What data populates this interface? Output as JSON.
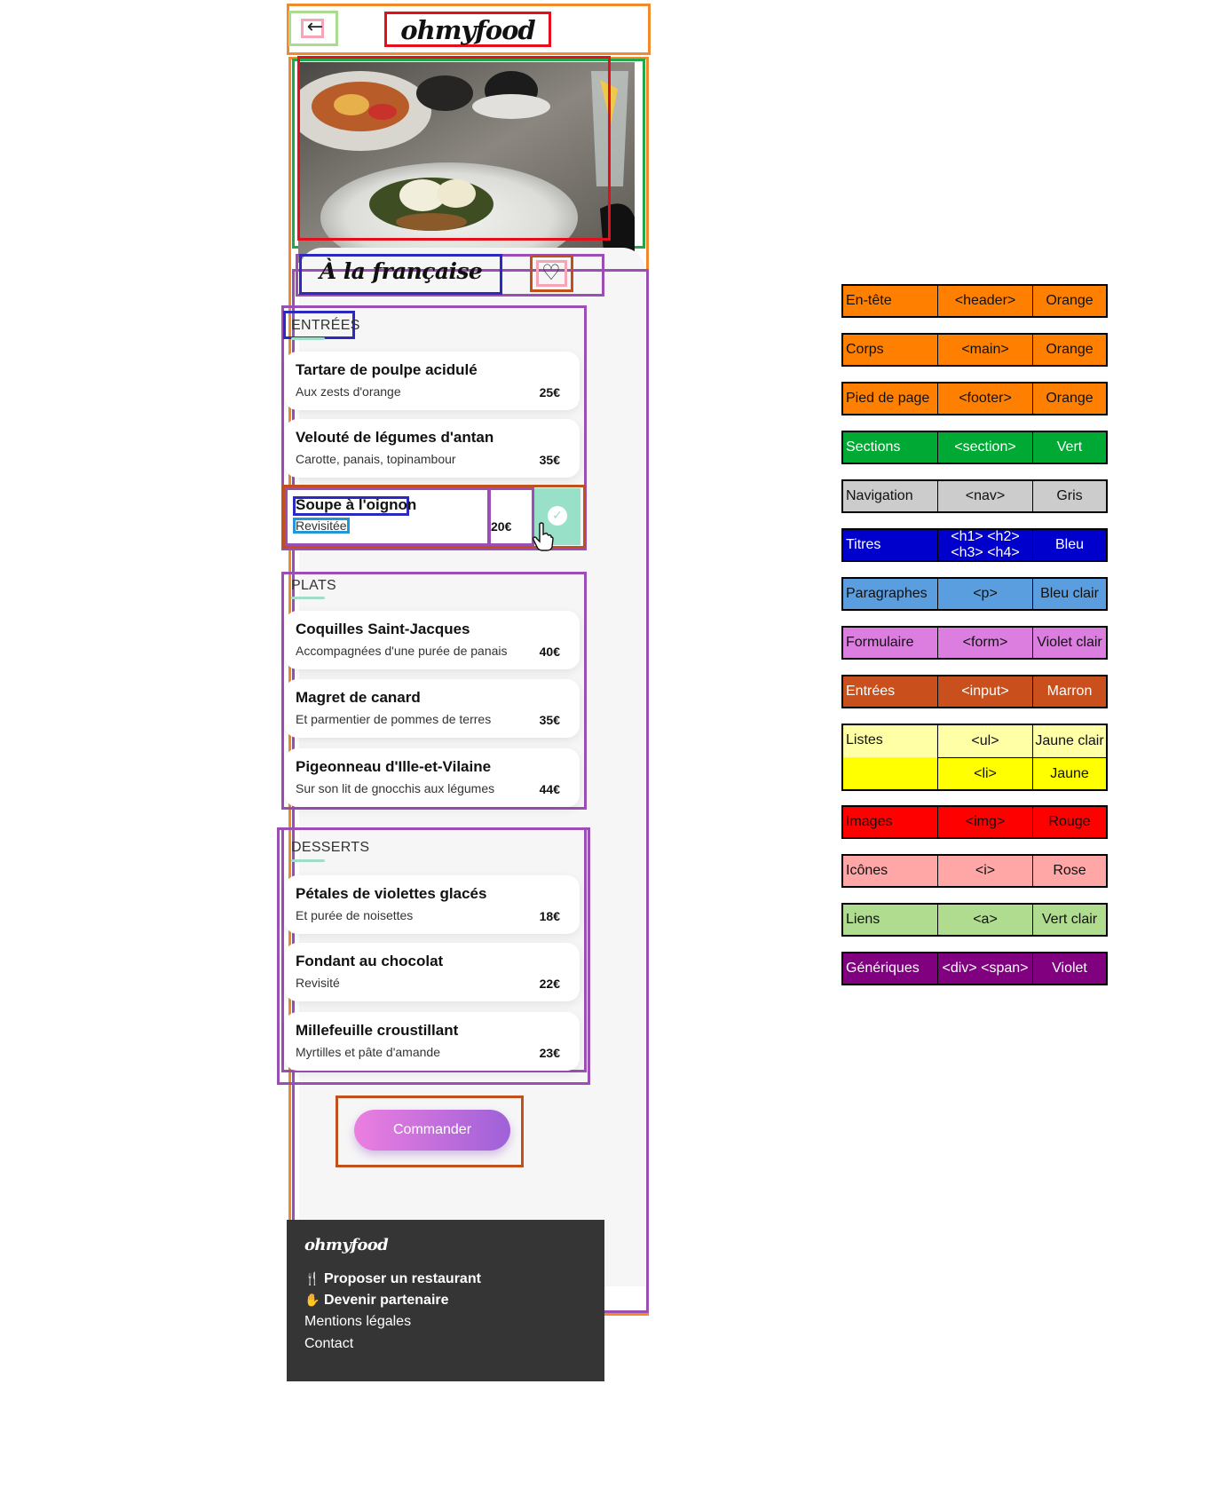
{
  "header": {
    "logo": "ohmyfood",
    "back_icon": "arrow-left-icon"
  },
  "restaurant": {
    "title": "À la française",
    "like_icon": "heart-icon"
  },
  "sections": [
    {
      "title": "ENTRÉES",
      "dishes": [
        {
          "name": "Tartare de poulpe acidulé",
          "desc": "Aux zests d'orange",
          "price": "25€"
        },
        {
          "name": "Velouté de légumes d'antan",
          "desc": "Carotte, panais, topinambour",
          "price": "35€"
        },
        {
          "name": "Soupe à l'oignon",
          "desc": "Revisitée",
          "price": "20€",
          "selected": true
        }
      ]
    },
    {
      "title": "PLATS",
      "dishes": [
        {
          "name": "Coquilles Saint-Jacques",
          "desc": "Accompagnées d'une purée de panais",
          "price": "40€"
        },
        {
          "name": "Magret de canard",
          "desc": "Et parmentier de pommes de terres",
          "price": "35€"
        },
        {
          "name": "Pigeonneau d'Ille-et-Vilaine",
          "desc": "Sur son lit de gnocchis aux légumes",
          "price": "44€"
        }
      ]
    },
    {
      "title": "DESSERTS",
      "dishes": [
        {
          "name": "Pétales de violettes glacés",
          "desc": "Et purée de noisettes",
          "price": "18€"
        },
        {
          "name": "Fondant au chocolat",
          "desc": "Revisité",
          "price": "22€"
        },
        {
          "name": "Millefeuille croustillant",
          "desc": "Myrtilles et pâte d'amande",
          "price": "23€"
        }
      ]
    }
  ],
  "order_button": "Commander",
  "footer": {
    "logo": "ohmyfood",
    "links": [
      {
        "label": "Proposer un restaurant",
        "icon": "utensils-icon"
      },
      {
        "label": "Devenir partenaire",
        "icon": "handshake-icon"
      },
      {
        "label": "Mentions légales"
      },
      {
        "label": "Contact"
      }
    ]
  },
  "legend": [
    {
      "name": "En-tête",
      "tag": "<header>",
      "color": "Orange",
      "hex": "#ff8000"
    },
    {
      "name": "Corps",
      "tag": "<main>",
      "color": "Orange",
      "hex": "#ff8000"
    },
    {
      "name": "Pied de page",
      "tag": "<footer>",
      "color": "Orange",
      "hex": "#ff8000"
    },
    {
      "name": "Sections",
      "tag": "<section>",
      "color": "Vert",
      "hex": "#00a933",
      "light_text": true
    },
    {
      "name": "Navigation",
      "tag": "<nav>",
      "color": "Gris",
      "hex": "#cccccc"
    },
    {
      "name": "Titres",
      "tag": "<h1> <h2> <h3> <h4>",
      "color": "Bleu",
      "hex": "#0000cc",
      "light_text": true
    },
    {
      "name": "Paragraphes",
      "tag": "<p>",
      "color": "Bleu clair",
      "hex": "#5a9ee0"
    },
    {
      "name": "Formulaire",
      "tag": "<form>",
      "color": "Violet clair",
      "hex": "#dc7ee0"
    },
    {
      "name": "Entrées",
      "tag": "<input>",
      "color": "Marron",
      "hex": "#c9501c",
      "light_text": true
    },
    {
      "name": "Listes",
      "tag": "<ul>",
      "color": "Jaune clair",
      "hex": "#ffffa6",
      "sub_tag": "<li>",
      "sub_color": "Jaune",
      "sub_hex": "#ffff00"
    },
    {
      "name": "Images",
      "tag": "<img>",
      "color": "Rouge",
      "hex": "#ff0000"
    },
    {
      "name": "Icônes",
      "tag": "<i>",
      "color": "Rose",
      "hex": "#ffa6a6"
    },
    {
      "name": "Liens",
      "tag": "<a>",
      "color": "Vert clair",
      "hex": "#afdc8f"
    },
    {
      "name": "Génériques",
      "tag": "<div> <span>",
      "color": "Violet",
      "hex": "#800080",
      "light_text": true
    }
  ]
}
